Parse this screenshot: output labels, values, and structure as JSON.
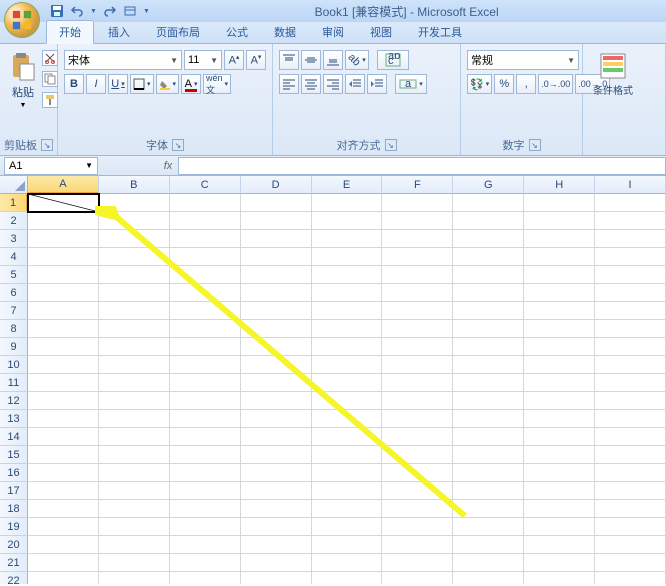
{
  "app": {
    "title": "Book1 [兼容模式] - Microsoft Excel"
  },
  "qat": {
    "save": "save-icon",
    "undo": "undo-icon",
    "redo": "redo-icon",
    "custom": "custom-icon"
  },
  "tabs": [
    "开始",
    "插入",
    "页面布局",
    "公式",
    "数据",
    "审阅",
    "视图",
    "开发工具"
  ],
  "active_tab": 0,
  "ribbon": {
    "clipboard": {
      "title": "剪贴板",
      "paste": "粘贴"
    },
    "font": {
      "title": "字体",
      "name": "宋体",
      "size": "11",
      "bold": "B",
      "italic": "I",
      "underline": "U"
    },
    "align": {
      "title": "对齐方式"
    },
    "number": {
      "title": "数字",
      "format": "常规"
    },
    "styles": {
      "cond": "条件格式"
    }
  },
  "namebox": {
    "ref": "A1",
    "fx": "fx"
  },
  "columns": [
    "A",
    "B",
    "C",
    "D",
    "E",
    "F",
    "G",
    "H",
    "I"
  ],
  "rows": [
    1,
    2,
    3,
    4,
    5,
    6,
    7,
    8,
    9,
    10,
    11,
    12,
    13,
    14,
    15,
    16,
    17,
    18,
    19,
    20,
    21,
    22
  ],
  "active_cell": {
    "col": 0,
    "row": 0
  }
}
